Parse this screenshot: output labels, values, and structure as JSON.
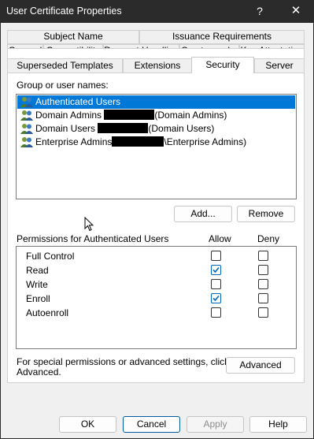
{
  "window": {
    "title": "User Certificate Properties",
    "help_glyph": "?",
    "close_glyph": "✕"
  },
  "tabs": {
    "row1": [
      "Subject Name",
      "Issuance Requirements"
    ],
    "row2": [
      "General",
      "Compatibility",
      "Request Handling",
      "Cryptography",
      "Key Attestation"
    ],
    "row3": [
      "Superseded Templates",
      "Extensions",
      "Security",
      "Server"
    ],
    "active": "Security"
  },
  "security": {
    "group_label": "Group or user names:",
    "users": [
      {
        "prefix": "Authenticated Users",
        "suffix": "",
        "selected": true
      },
      {
        "prefix": "Domain Admins ",
        "suffix": "(Domain Admins)",
        "selected": false
      },
      {
        "prefix": "Domain Users ",
        "suffix": "(Domain Users)",
        "selected": false
      },
      {
        "prefix": "Enterprise Admins",
        "suffix": "\\Enterprise Admins)",
        "selected": false
      }
    ],
    "add_button": "Add...",
    "remove_button": "Remove",
    "permissions_label": "Permissions for Authenticated Users",
    "allow_header": "Allow",
    "deny_header": "Deny",
    "permissions": [
      {
        "name": "Full Control",
        "allow": false,
        "deny": false
      },
      {
        "name": "Read",
        "allow": true,
        "deny": false
      },
      {
        "name": "Write",
        "allow": false,
        "deny": false
      },
      {
        "name": "Enroll",
        "allow": true,
        "deny": false
      },
      {
        "name": "Autoenroll",
        "allow": false,
        "deny": false
      }
    ],
    "advanced_text_line1": "For special permissions or advanced settings, click",
    "advanced_text_line2": "Advanced.",
    "advanced_button": "Advanced"
  },
  "footer": {
    "ok": "OK",
    "cancel": "Cancel",
    "apply": "Apply",
    "help": "Help"
  },
  "colors": {
    "selection": "#0078d7",
    "checkbox": "#0067c0",
    "titlebar": "#2b2b2b"
  }
}
